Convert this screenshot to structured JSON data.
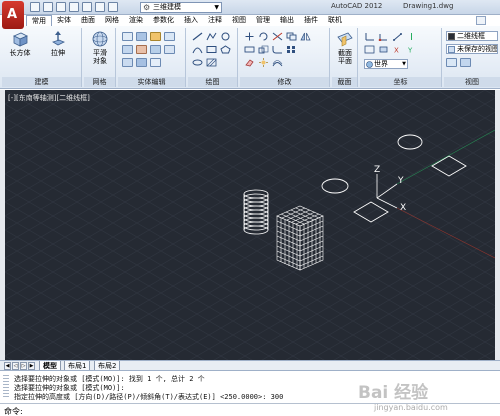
{
  "titlebar": {
    "app_title": "AutoCAD 2012",
    "doc_title": "Drawing1.dwg",
    "workspace": "三维建模",
    "app_icon": "A"
  },
  "tabs": [
    "常用",
    "实体",
    "曲面",
    "网格",
    "渲染",
    "参数化",
    "插入",
    "注释",
    "视图",
    "管理",
    "输出",
    "插件",
    "联机"
  ],
  "ribbon": {
    "panels": {
      "modeling": "建模",
      "mesh": "网格",
      "solid_edit": "实体编辑",
      "draw": "绘图",
      "modify": "修改",
      "section": "截面",
      "coordinates": "坐标",
      "view": "视图"
    },
    "buttons": {
      "box": "长方体",
      "extrude": "拉伸",
      "smooth": "平滑\n对象",
      "section_plane": "截面\n平面"
    },
    "visual_style": "二维线框",
    "saved_view": "未保存的视图",
    "ucs": "世界"
  },
  "viewport": {
    "label": "[-][东南等轴测][二维线框]",
    "ucs_axis_x": "X",
    "ucs_axis_y": "Y",
    "ucs_axis_z": "Z"
  },
  "layout_tabs": [
    "模型",
    "布局1",
    "布局2"
  ],
  "command": {
    "history": [
      "选择要拉伸的对象或 [模式(MO)]: 找到 1 个, 总计 2 个",
      "选择要拉伸的对象或 [模式(MO)]:",
      "指定拉伸的高度或 [方向(D)/路径(P)/倾斜角(T)/表达式(E)] <250.0000>: 300"
    ],
    "prompt": "命令:"
  },
  "watermark": {
    "logo": "Bai 经验",
    "url": "jingyan.baidu.com"
  },
  "colors": {
    "canvas_bg": "#252a33",
    "wireframe": "#ffffff",
    "grid": "#2f3540",
    "axis_x": "#c0392b",
    "axis_y": "#27ae60"
  }
}
